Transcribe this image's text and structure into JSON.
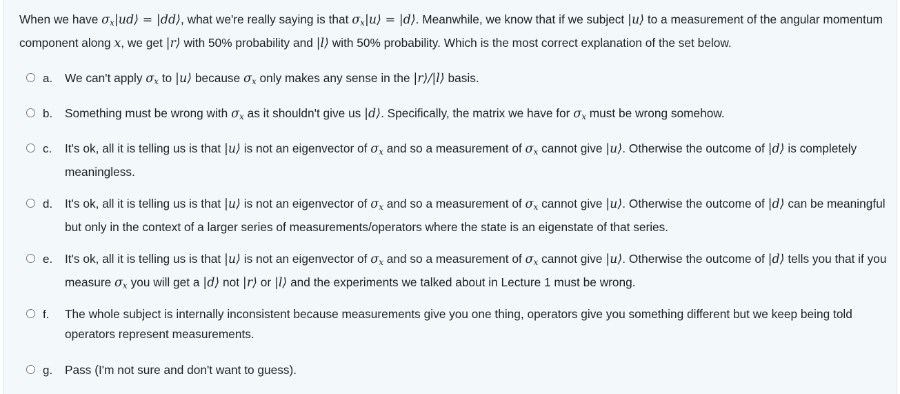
{
  "question": {
    "parts": [
      "When we have ",
      "σ",
      "x",
      "|ud⟩ = |dd⟩",
      ", what we're really saying is that ",
      "σ",
      "x",
      "|u⟩ = |d⟩",
      ". Meanwhile, we know that if we subject ",
      "|u⟩",
      " to a measurement of the angular momentum component along ",
      "x",
      ", we get ",
      "|r⟩",
      " with 50% probability and ",
      "|l⟩",
      " with 50% probability. Which is the most correct explanation of the set below."
    ]
  },
  "answers": [
    {
      "letter": "a.",
      "parts": [
        "We can't apply ",
        "σ",
        "x",
        " to ",
        "|u⟩",
        " because ",
        "σ",
        "x",
        " only makes any sense in the ",
        "|r⟩/|l⟩",
        " basis."
      ]
    },
    {
      "letter": "b.",
      "parts": [
        "Something must be wrong with ",
        "σ",
        "x",
        " as it shouldn't give us ",
        "|d⟩",
        ". Specifically, the matrix we have for ",
        "σ",
        "x",
        " must be wrong somehow."
      ]
    },
    {
      "letter": "c.",
      "parts": [
        "It's ok, all it is telling us is that ",
        "|u⟩",
        " is not an eigenvector of ",
        "σ",
        "x",
        " and so a measurement of ",
        "σ",
        "x",
        " cannot give ",
        "|u⟩",
        ". Otherwise the outcome of ",
        "|d⟩",
        " is completely meaningless."
      ]
    },
    {
      "letter": "d.",
      "parts": [
        "It's ok, all it is telling us is that ",
        "|u⟩",
        " is not an eigenvector of ",
        "σ",
        "x",
        " and so a measurement of ",
        "σ",
        "x",
        " cannot give ",
        "|u⟩",
        ". Otherwise the outcome of ",
        "|d⟩",
        " can be meaningful but only in the context of a larger series of measurements/operators where the state is an eigenstate of that series."
      ]
    },
    {
      "letter": "e.",
      "parts": [
        "It's ok, all it is telling us is that ",
        "|u⟩",
        " is not an eigenvector of ",
        "σ",
        "x",
        " and so a measurement of ",
        "σ",
        "x",
        " cannot give ",
        "|u⟩",
        ". Otherwise the outcome of ",
        "|d⟩",
        " tells you that if you measure ",
        "σ",
        "x",
        " you will get a ",
        "|d⟩",
        " not ",
        "|r⟩",
        " or ",
        "|l⟩",
        " and the experiments we talked about in Lecture 1 must be wrong."
      ]
    },
    {
      "letter": "f.",
      "parts": [
        "The whole subject is internally inconsistent because measurements give you one thing, operators give you something different but we keep being told operators represent measurements."
      ]
    },
    {
      "letter": "g.",
      "parts": [
        "Pass (I'm not sure and don't want to guess)."
      ]
    }
  ]
}
